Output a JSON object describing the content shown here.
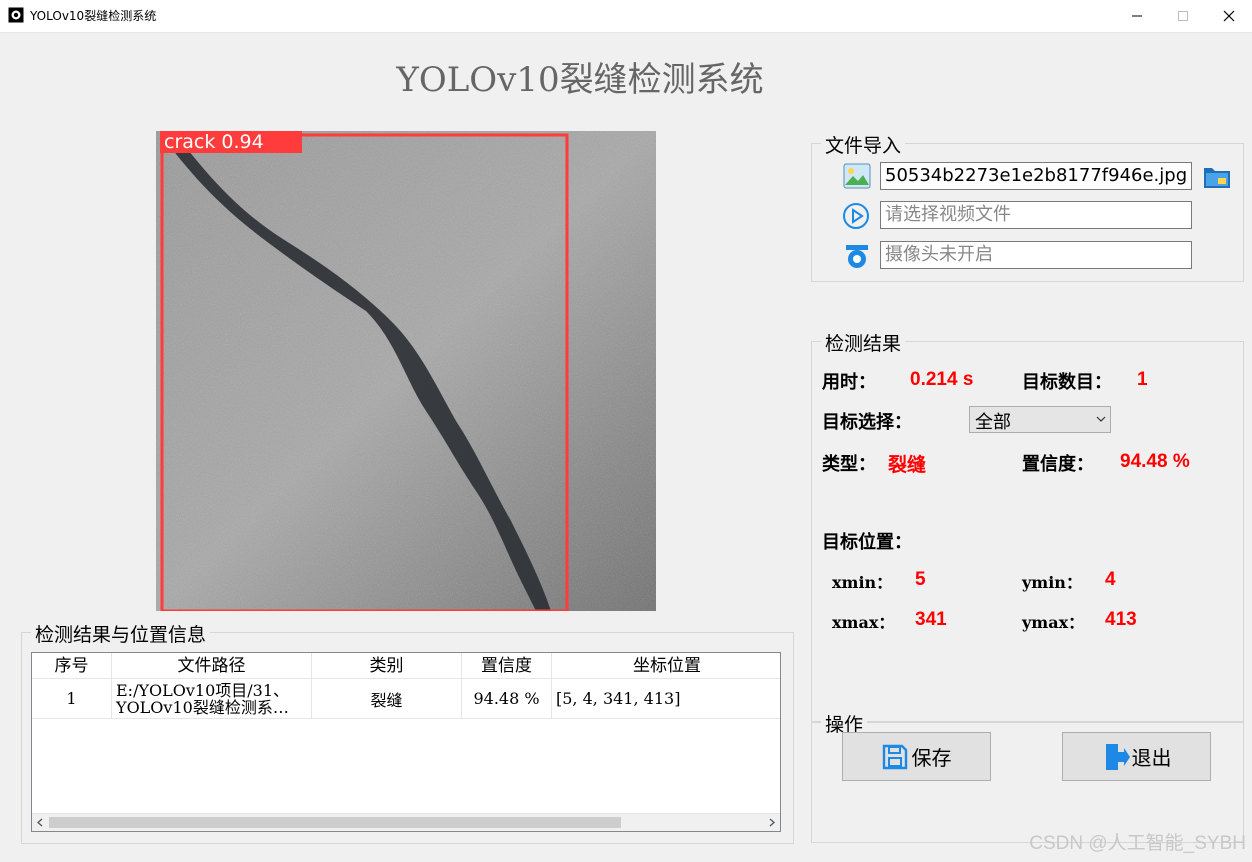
{
  "window": {
    "title": "YOLOv10裂缝检测系统",
    "icon": "app-icon",
    "controls": [
      "minimize-icon",
      "maximize-icon",
      "close-icon"
    ]
  },
  "header": {
    "title": "YOLOv10裂缝检测系统"
  },
  "image": {
    "detection_label": "crack 0.94",
    "box_color": "#ff3b3b"
  },
  "file_import": {
    "title": "文件导入",
    "image_file_value": "50534b2273e1e2b8177f946e.jpg",
    "video_placeholder": "请选择视频文件",
    "camera_placeholder": "摄像头未开启",
    "icons": [
      "image-icon",
      "play-icon",
      "camera-icon",
      "folder-icon"
    ]
  },
  "results": {
    "title": "检测结果",
    "time_label": "用时：",
    "time_value": "0.214 s",
    "count_label": "目标数目：",
    "count_value": "1",
    "select_label": "目标选择：",
    "select_value": "全部",
    "type_label": "类型：",
    "type_value": "裂缝",
    "conf_label": "置信度：",
    "conf_value": "94.48 %",
    "pos_label": "目标位置：",
    "xmin_label": "xmin：",
    "xmin_value": "5",
    "ymin_label": "ymin：",
    "ymin_value": "4",
    "xmax_label": "xmax：",
    "xmax_value": "341",
    "ymax_label": "ymax：",
    "ymax_value": "413"
  },
  "operations": {
    "title": "操作",
    "save_label": "保存",
    "exit_label": "退出"
  },
  "table": {
    "title": "检测结果与位置信息",
    "columns": [
      "序号",
      "文件路径",
      "类别",
      "置信度",
      "坐标位置"
    ],
    "rows": [
      {
        "index": "1",
        "path_line1": "E:/YOLOv10项目/31、",
        "path_line2": "YOLOv10裂缝检测系…",
        "category": "裂缝",
        "confidence": "94.48 %",
        "coords": "[5, 4, 341, 413]"
      }
    ]
  },
  "watermark": "CSDN @人工智能_SYBH",
  "colors": {
    "accent_red": "#ff0000",
    "icon_blue": "#1e88e5"
  }
}
